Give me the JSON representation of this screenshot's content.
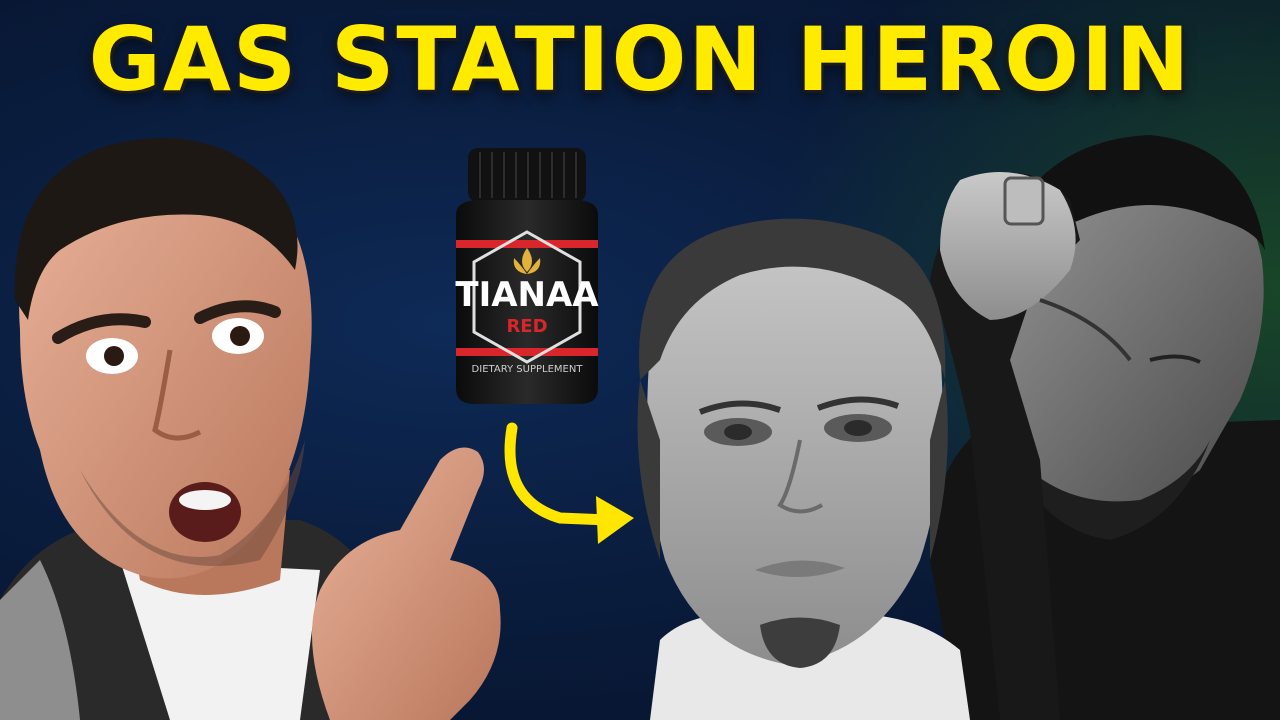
{
  "headline": "GAS STATION HEROIN",
  "product": {
    "brand": "TIANAA",
    "variant": "RED",
    "label": "DIETARY SUPPLEMENT"
  },
  "colors": {
    "headline": "#ffeb00",
    "arrow": "#ffe600",
    "background": "#0a1d3e",
    "bottle_accent": "#d8262a"
  },
  "icons": [
    "lotus-icon",
    "curved-arrow-icon",
    "pointing-finger"
  ]
}
